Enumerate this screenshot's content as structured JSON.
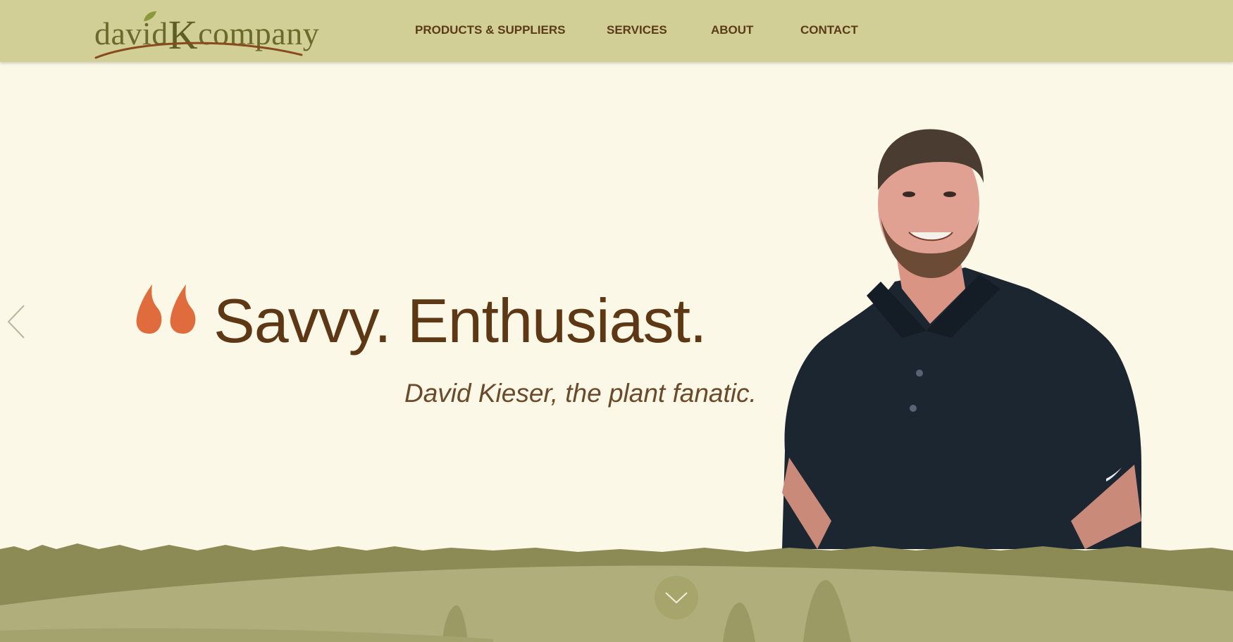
{
  "header": {
    "logo": {
      "text_before": "david",
      "text_k": "K",
      "text_after": "company"
    },
    "nav": [
      {
        "label": "PRODUCTS & SUPPLIERS"
      },
      {
        "label": "SERVICES"
      },
      {
        "label": "ABOUT"
      },
      {
        "label": "CONTACT"
      }
    ]
  },
  "hero": {
    "headline": "Savvy. Enthusiast.",
    "attribution": "David Kieser, the plant fanatic.",
    "icons": {
      "quote": "quote-icon",
      "prev": "chevron-left-icon",
      "scroll": "chevron-down-icon"
    }
  },
  "colors": {
    "header_bg": "#d2cf96",
    "page_bg": "#fbf8e7",
    "headline": "#5e3815",
    "quote_accent": "#e06b3c",
    "nav_text": "#5a3b18",
    "hill_dark": "#8d8b55",
    "hill_light": "#b0ae7b"
  }
}
